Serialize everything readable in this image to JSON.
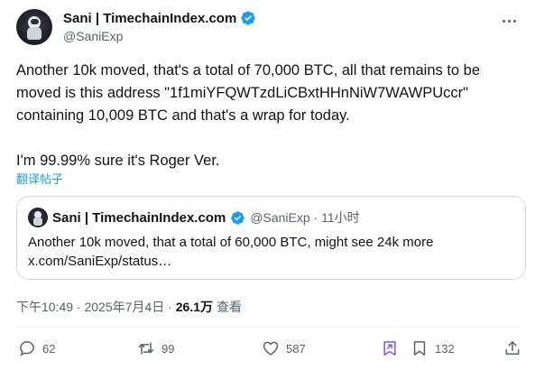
{
  "author": {
    "display_name": "Sani | TimechainIndex.com",
    "handle": "@SaniExp"
  },
  "tweet": {
    "text": "Another 10k moved, that's a total of 70,000 BTC, all that remains to be moved is this address \"1f1miYFQWTzdLiCBxtHHnNiW7WAWPUccr\" containing 10,009 BTC and that's a wrap for today.\n\nI'm 99.99% sure it's Roger Ver.",
    "translate_label": "翻译帖子"
  },
  "quote": {
    "display_name": "Sani | TimechainIndex.com",
    "handle_time": "@SaniExp · 11小时",
    "text": "Another 10k moved, that a total of 60,000 BTC, might see 24k more x.com/SaniExp/status…"
  },
  "meta": {
    "timestamp": "下午10:49 · 2025年7月4日 ·",
    "views": "26.1万",
    "views_label": "查看"
  },
  "actions": {
    "replies": "62",
    "reposts": "99",
    "likes": "587",
    "bookmarks": "132"
  },
  "colors": {
    "accent": "#1d9bf0",
    "text": "#0f1419",
    "muted": "#536471",
    "border": "#cfd9de"
  },
  "icons": [
    "more-icon",
    "verified-icon",
    "reply-icon",
    "repost-icon",
    "like-icon",
    "grok-icon",
    "bookmark-icon",
    "share-icon"
  ]
}
